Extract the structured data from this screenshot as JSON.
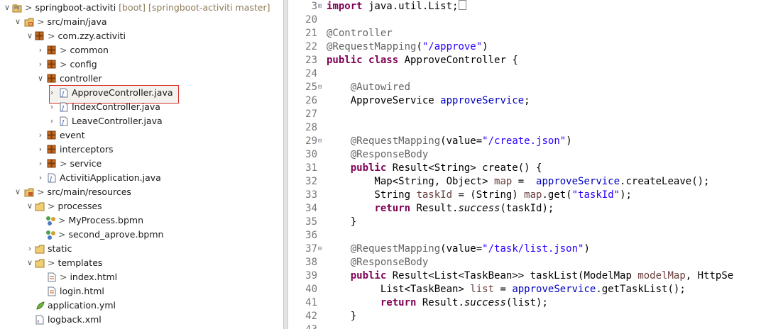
{
  "tree": {
    "project": {
      "name": "springboot-activiti",
      "decoration": "[boot] [springboot-activiti master]"
    },
    "rows": [
      {
        "id": "r0",
        "label": "springboot-activiti",
        "prefix": "> ",
        "icon": "project-icon",
        "toggle": "down"
      },
      {
        "id": "r1",
        "label": "src/main/java",
        "prefix": "> ",
        "icon": "source-folder-icon",
        "toggle": "down"
      },
      {
        "id": "r2",
        "label": "com.zzy.activiti",
        "prefix": "> ",
        "icon": "package-icon",
        "toggle": "down"
      },
      {
        "id": "r3",
        "label": "common",
        "prefix": "> ",
        "icon": "package-icon",
        "toggle": "right"
      },
      {
        "id": "r4",
        "label": "config",
        "prefix": "> ",
        "icon": "package-icon",
        "toggle": "right"
      },
      {
        "id": "r5",
        "label": "controller",
        "prefix": "",
        "icon": "package-icon",
        "toggle": "down"
      },
      {
        "id": "r6",
        "label": "ApproveController.java",
        "prefix": "",
        "icon": "java-file-icon",
        "toggle": "right"
      },
      {
        "id": "r7",
        "label": "IndexController.java",
        "prefix": "",
        "icon": "java-file-icon",
        "toggle": "right"
      },
      {
        "id": "r8",
        "label": "LeaveController.java",
        "prefix": "",
        "icon": "java-file-icon",
        "toggle": "right"
      },
      {
        "id": "r9",
        "label": "event",
        "prefix": "",
        "icon": "package-icon",
        "toggle": "right"
      },
      {
        "id": "r10",
        "label": "interceptors",
        "prefix": "",
        "icon": "package-icon",
        "toggle": "right"
      },
      {
        "id": "r11",
        "label": "service",
        "prefix": "> ",
        "icon": "package-icon",
        "toggle": "right"
      },
      {
        "id": "r12",
        "label": "ActivitiApplication.java",
        "prefix": "",
        "icon": "java-file-icon",
        "toggle": "right"
      },
      {
        "id": "r13",
        "label": "src/main/resources",
        "prefix": "> ",
        "icon": "resource-folder-icon",
        "toggle": "down"
      },
      {
        "id": "r14",
        "label": "processes",
        "prefix": "> ",
        "icon": "folder-icon",
        "toggle": "down"
      },
      {
        "id": "r15",
        "label": "MyProcess.bpmn",
        "prefix": "> ",
        "icon": "bpmn-file-icon",
        "toggle": "none"
      },
      {
        "id": "r16",
        "label": "second_aprove.bpmn",
        "prefix": "> ",
        "icon": "bpmn-file-icon",
        "toggle": "none"
      },
      {
        "id": "r17",
        "label": "static",
        "prefix": "",
        "icon": "folder-icon",
        "toggle": "right"
      },
      {
        "id": "r18",
        "label": "templates",
        "prefix": "> ",
        "icon": "folder-icon",
        "toggle": "down"
      },
      {
        "id": "r19",
        "label": "index.html",
        "prefix": "> ",
        "icon": "html-file-icon",
        "toggle": "none"
      },
      {
        "id": "r20",
        "label": "login.html",
        "prefix": "",
        "icon": "html-file-icon",
        "toggle": "none"
      },
      {
        "id": "r21",
        "label": "application.yml",
        "prefix": "",
        "icon": "yml-file-icon",
        "toggle": "none"
      },
      {
        "id": "r22",
        "label": "logback.xml",
        "prefix": "",
        "icon": "xml-file-icon",
        "toggle": "none"
      }
    ],
    "selected_item": "ApproveController.java"
  },
  "editor": {
    "lines": [
      {
        "n": "3",
        "fold": "plus",
        "tokens": [
          {
            "t": "import",
            "c": "kw"
          },
          {
            "t": " java.util.List;",
            "c": ""
          }
        ]
      },
      {
        "n": "20",
        "fold": "",
        "tokens": []
      },
      {
        "n": "21",
        "fold": "",
        "tokens": [
          {
            "t": "@Controller",
            "c": "ann"
          }
        ]
      },
      {
        "n": "22",
        "fold": "",
        "tokens": [
          {
            "t": "@RequestMapping",
            "c": "ann"
          },
          {
            "t": "(",
            "c": ""
          },
          {
            "t": "\"/approve\"",
            "c": "str"
          },
          {
            "t": ")",
            "c": ""
          }
        ]
      },
      {
        "n": "23",
        "fold": "",
        "tokens": [
          {
            "t": "public",
            "c": "kw"
          },
          {
            "t": " ",
            "c": ""
          },
          {
            "t": "class",
            "c": "kw"
          },
          {
            "t": " ApproveController {",
            "c": ""
          }
        ]
      },
      {
        "n": "24",
        "fold": "",
        "tokens": []
      },
      {
        "n": "25",
        "fold": "minus",
        "tokens": [
          {
            "t": "    ",
            "c": ""
          },
          {
            "t": "@Autowired",
            "c": "ann"
          }
        ]
      },
      {
        "n": "26",
        "fold": "",
        "tokens": [
          {
            "t": "    ApproveService ",
            "c": ""
          },
          {
            "t": "approveService",
            "c": "fld"
          },
          {
            "t": ";",
            "c": ""
          }
        ]
      },
      {
        "n": "27",
        "fold": "",
        "tokens": []
      },
      {
        "n": "28",
        "fold": "",
        "tokens": []
      },
      {
        "n": "29",
        "fold": "minus",
        "tokens": [
          {
            "t": "    ",
            "c": ""
          },
          {
            "t": "@RequestMapping",
            "c": "ann"
          },
          {
            "t": "(value=",
            "c": ""
          },
          {
            "t": "\"/create.json\"",
            "c": "str"
          },
          {
            "t": ")",
            "c": ""
          }
        ]
      },
      {
        "n": "30",
        "fold": "",
        "tokens": [
          {
            "t": "    ",
            "c": ""
          },
          {
            "t": "@ResponseBody",
            "c": "ann"
          }
        ]
      },
      {
        "n": "31",
        "fold": "",
        "tokens": [
          {
            "t": "    ",
            "c": ""
          },
          {
            "t": "public",
            "c": "kw"
          },
          {
            "t": " Result<String> create() {",
            "c": ""
          }
        ]
      },
      {
        "n": "32",
        "fold": "",
        "tokens": [
          {
            "t": "        Map<String, Object> ",
            "c": ""
          },
          {
            "t": "map",
            "c": "loc"
          },
          {
            "t": " =  ",
            "c": ""
          },
          {
            "t": "approveService",
            "c": "fld"
          },
          {
            "t": ".createLeave();",
            "c": ""
          }
        ]
      },
      {
        "n": "33",
        "fold": "",
        "tokens": [
          {
            "t": "        String ",
            "c": ""
          },
          {
            "t": "taskId",
            "c": "loc"
          },
          {
            "t": " = (String) ",
            "c": ""
          },
          {
            "t": "map",
            "c": "loc"
          },
          {
            "t": ".get(",
            "c": ""
          },
          {
            "t": "\"taskId\"",
            "c": "str"
          },
          {
            "t": ");",
            "c": ""
          }
        ]
      },
      {
        "n": "34",
        "fold": "",
        "tokens": [
          {
            "t": "        ",
            "c": ""
          },
          {
            "t": "return",
            "c": "kw"
          },
          {
            "t": " Result.",
            "c": ""
          },
          {
            "t": "success",
            "c": "ital"
          },
          {
            "t": "(taskId);",
            "c": ""
          }
        ]
      },
      {
        "n": "35",
        "fold": "",
        "tokens": [
          {
            "t": "    }",
            "c": ""
          }
        ]
      },
      {
        "n": "36",
        "fold": "",
        "tokens": []
      },
      {
        "n": "37",
        "fold": "minus",
        "tokens": [
          {
            "t": "    ",
            "c": ""
          },
          {
            "t": "@RequestMapping",
            "c": "ann"
          },
          {
            "t": "(value=",
            "c": ""
          },
          {
            "t": "\"/task/list.json\"",
            "c": "str"
          },
          {
            "t": ")",
            "c": ""
          }
        ]
      },
      {
        "n": "38",
        "fold": "",
        "tokens": [
          {
            "t": "    ",
            "c": ""
          },
          {
            "t": "@ResponseBody",
            "c": "ann"
          }
        ]
      },
      {
        "n": "39",
        "fold": "",
        "tokens": [
          {
            "t": "    ",
            "c": ""
          },
          {
            "t": "public",
            "c": "kw"
          },
          {
            "t": " Result<List<TaskBean>> taskList(ModelMap ",
            "c": ""
          },
          {
            "t": "modelMap",
            "c": "loc"
          },
          {
            "t": ", HttpSe",
            "c": ""
          }
        ]
      },
      {
        "n": "40",
        "fold": "",
        "tokens": [
          {
            "t": "         List<TaskBean> ",
            "c": ""
          },
          {
            "t": "list",
            "c": "loc"
          },
          {
            "t": " = ",
            "c": ""
          },
          {
            "t": "approveService",
            "c": "fld"
          },
          {
            "t": ".getTaskList();",
            "c": ""
          }
        ]
      },
      {
        "n": "41",
        "fold": "",
        "tokens": [
          {
            "t": "         ",
            "c": ""
          },
          {
            "t": "return",
            "c": "kw"
          },
          {
            "t": " Result.",
            "c": ""
          },
          {
            "t": "success",
            "c": "ital"
          },
          {
            "t": "(list);",
            "c": ""
          }
        ]
      },
      {
        "n": "42",
        "fold": "",
        "tokens": [
          {
            "t": "    }",
            "c": ""
          }
        ]
      },
      {
        "n": "43",
        "fold": "",
        "tokens": []
      }
    ]
  }
}
